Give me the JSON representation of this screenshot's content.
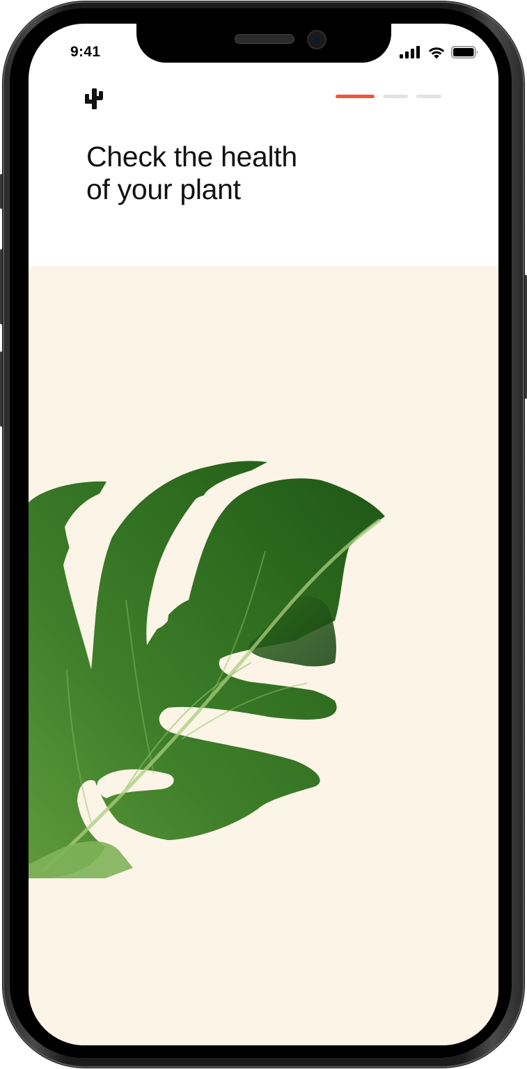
{
  "status_bar": {
    "time": "9:41",
    "signal_icon": "cellular-signal-icon",
    "wifi_icon": "wifi-icon",
    "battery_icon": "battery-icon"
  },
  "header": {
    "logo_icon": "cactus-icon",
    "progress": {
      "total_steps": 3,
      "current_step": 1,
      "active_color": "#f0553a",
      "inactive_color": "#e2e2e2"
    }
  },
  "headline": {
    "line1": "Check the health",
    "line2": "of your plant"
  },
  "hero": {
    "background_color": "#fcf4e6",
    "image": "monstera-leaf"
  }
}
